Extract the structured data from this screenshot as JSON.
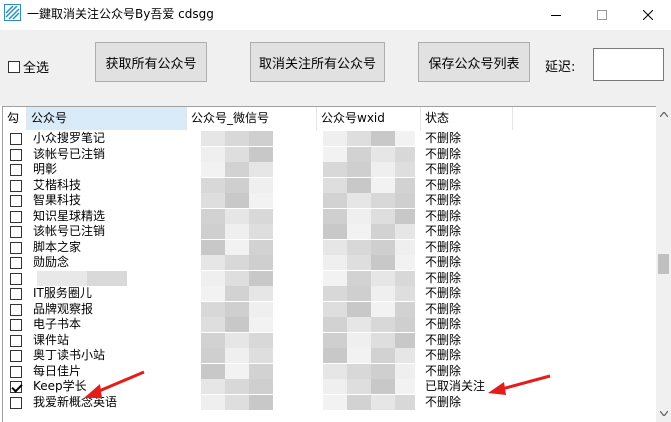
{
  "window": {
    "title": "一鍵取消关注公众号By吾爱 cdsgg",
    "accent": "#e31c1c"
  },
  "toolbar": {
    "select_all_label": "全选",
    "fetch_button": "获取所有公众号",
    "unfollow_button": "取消关注所有公众号",
    "save_button": "保存公众号列表",
    "delay_label": "延迟:",
    "delay_value": ""
  },
  "grid": {
    "columns": {
      "check": "勾",
      "name": "公众号",
      "wechat_id": "公众号_微信号",
      "wxid": "公众号wxid",
      "status": "状态"
    },
    "rows": [
      {
        "checked": false,
        "name": "小众搜罗笔记",
        "status": "不删除"
      },
      {
        "checked": false,
        "name": "该帐号已注销",
        "status": "不删除"
      },
      {
        "checked": false,
        "name": "明彰",
        "status": "不删除"
      },
      {
        "checked": false,
        "name": "艾楷科技",
        "status": "不删除"
      },
      {
        "checked": false,
        "name": "智果科技",
        "status": "不删除"
      },
      {
        "checked": false,
        "name": "知识星球精选",
        "status": "不删除"
      },
      {
        "checked": false,
        "name": "该帐号已注销",
        "status": "不删除"
      },
      {
        "checked": false,
        "name": "脚本之家",
        "status": "不删除"
      },
      {
        "checked": false,
        "name": "勋励念",
        "status": "不删除"
      },
      {
        "checked": false,
        "name": "",
        "status": "不删除"
      },
      {
        "checked": false,
        "name": "IT服务圈儿",
        "status": "不删除"
      },
      {
        "checked": false,
        "name": "品牌观察报",
        "status": "不删除"
      },
      {
        "checked": false,
        "name": "电子书本",
        "status": "不删除"
      },
      {
        "checked": false,
        "name": "课件站",
        "status": "不删除"
      },
      {
        "checked": false,
        "name": "奥丁读书小站",
        "status": "不删除"
      },
      {
        "checked": false,
        "name": "每日佳片",
        "status": "不删除"
      },
      {
        "checked": true,
        "name": "Keep学长",
        "status": "已取消关注"
      },
      {
        "checked": false,
        "name": "我爱新概念英语",
        "status": "不删除"
      }
    ]
  }
}
